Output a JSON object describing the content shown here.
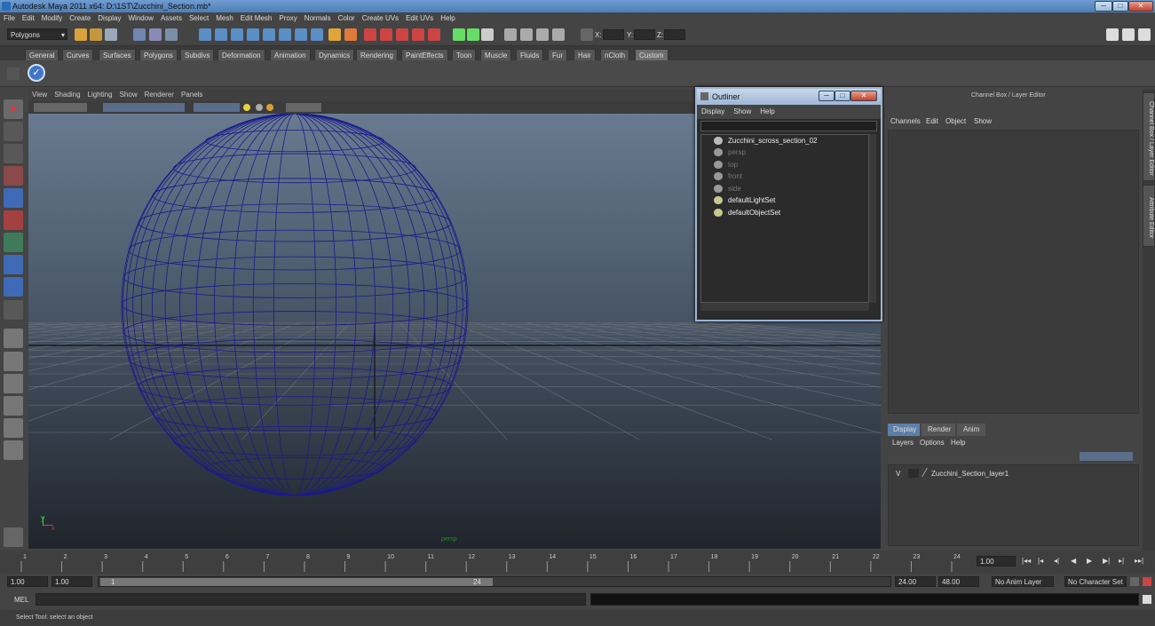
{
  "window": {
    "title": "Autodesk Maya 2011 x64: D:\\1ST\\Zucchini_Section.mb*",
    "min": "─",
    "max": "□",
    "close": "✕"
  },
  "menubar": [
    "File",
    "Edit",
    "Modify",
    "Create",
    "Display",
    "Window",
    "Assets",
    "Select",
    "Mesh",
    "Edit Mesh",
    "Proxy",
    "Normals",
    "Color",
    "Create UVs",
    "Edit UVs",
    "Help"
  ],
  "statusline": {
    "mode": "Polygons",
    "x_label": "X:",
    "y_label": "Y:",
    "z_label": "Z:"
  },
  "shelf_tabs": [
    "General",
    "Curves",
    "Surfaces",
    "Polygons",
    "Subdivs",
    "Deformation",
    "Animation",
    "Dynamics",
    "Rendering",
    "PaintEffects",
    "Toon",
    "Muscle",
    "Fluids",
    "Fur",
    "Hair",
    "nCloth",
    "Custom"
  ],
  "active_shelf": "Custom",
  "viewport": {
    "menu": [
      "View",
      "Shading",
      "Lighting",
      "Show",
      "Renderer",
      "Panels"
    ],
    "camera_label": "persp",
    "axis_y": "y",
    "axis_x": "x"
  },
  "outliner": {
    "title": "Outliner",
    "menu": [
      "Display",
      "Show",
      "Help"
    ],
    "items": [
      {
        "label": "Zucchini_scross_section_02",
        "dim": false
      },
      {
        "label": "persp",
        "dim": true
      },
      {
        "label": "top",
        "dim": true
      },
      {
        "label": "front",
        "dim": true
      },
      {
        "label": "side",
        "dim": true
      },
      {
        "label": "defaultLightSet",
        "dim": false
      },
      {
        "label": "defaultObjectSet",
        "dim": false
      }
    ]
  },
  "channel_box": {
    "title": "Channel Box / Layer Editor",
    "menu": [
      "Channels",
      "Edit",
      "Object",
      "Show"
    ],
    "layer_tabs": [
      "Display",
      "Render",
      "Anim"
    ],
    "layer_menu": [
      "Layers",
      "Options",
      "Help"
    ],
    "layer": {
      "visible": "V",
      "name": "Zucchini_Section_layer1"
    }
  },
  "side_tabs": [
    "Channel Box / Layer Editor",
    "Attribute Editor"
  ],
  "timeline": {
    "ticks": [
      "1",
      "2",
      "3",
      "4",
      "5",
      "6",
      "7",
      "8",
      "9",
      "10",
      "11",
      "12",
      "13",
      "14",
      "15",
      "16",
      "17",
      "18",
      "19",
      "20",
      "21",
      "22",
      "23",
      "24"
    ],
    "current_frame": "1.00",
    "controls": [
      "|◂◂",
      "|◂",
      "◂|",
      "◀",
      "▶",
      "▶|",
      "▸|",
      "▸▸|"
    ]
  },
  "range": {
    "start": "1.00",
    "start2": "1.00",
    "slider_start": "1",
    "slider_end": "24",
    "end": "24.00",
    "end2": "48.00",
    "anim_layer": "No Anim Layer",
    "char_set": "No Character Set"
  },
  "mel": {
    "label": "MEL"
  },
  "help_line": "Select Tool: select an object",
  "colors": {
    "wire": "#1a1a8c",
    "grid": "#6a6f78",
    "accent": "#5c8ed0"
  }
}
